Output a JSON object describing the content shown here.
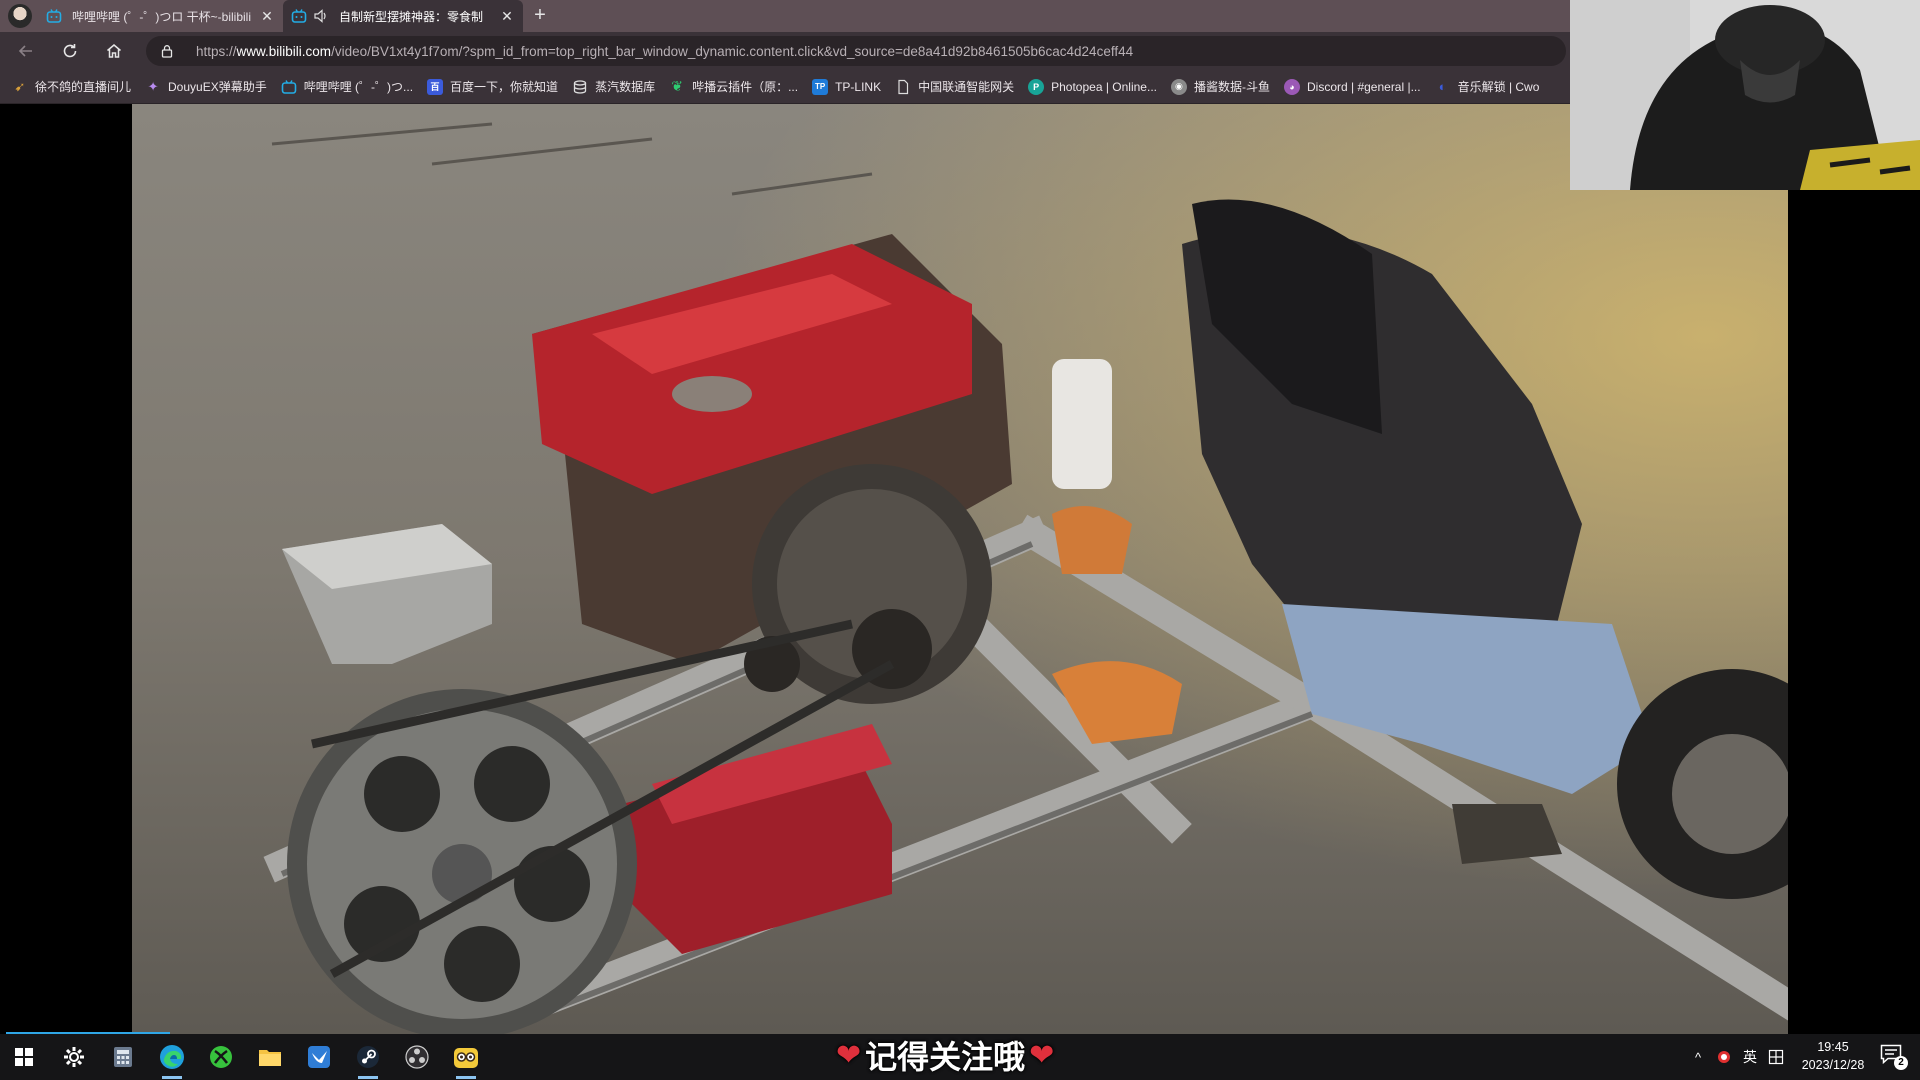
{
  "browser": {
    "tabs": [
      {
        "title": "哔哩哔哩 (゜-゜)つロ 干杯~-bilibili",
        "active": false,
        "icon": "bilibili-icon"
      },
      {
        "title": "自制新型摆摊神器：零食制",
        "active": true,
        "icon": "bilibili-icon"
      }
    ],
    "new_tab_icon": "plus-icon",
    "toolbar": {
      "back_icon": "back-arrow-icon",
      "reload_icon": "reload-icon",
      "home_icon": "home-icon"
    },
    "address": {
      "url_prefix": "https://",
      "url_domain": "www.bilibili.com",
      "url_rest": "/video/BV1xt4y1f7om/?spm_id_from=top_right_bar_window_dynamic.content.click&vd_source=de8a41d92b8461505b6cac4d24ceff44"
    },
    "bookmarks": [
      {
        "label": "徐不鸽的直播间儿",
        "icon": "pin-icon",
        "color": "#d9a03a"
      },
      {
        "label": "DouyuEX弹幕助手",
        "icon": "extension-icon",
        "color": "#b98cf0"
      },
      {
        "label": "哔哩哔哩 (゜-゜)つ...",
        "icon": "bilibili-icon",
        "color": "#23ade5"
      },
      {
        "label": "百度一下，你就知道",
        "icon": "baidu-icon",
        "color": "#3b5bdb"
      },
      {
        "label": "蒸汽数据库",
        "icon": "database-icon",
        "color": "#dcdcdc"
      },
      {
        "label": "哔播云插件（原：...",
        "icon": "leaf-icon",
        "color": "#2ecc71"
      },
      {
        "label": "TP-LINK",
        "icon": "tplink-icon",
        "color": "#1f7bd8"
      },
      {
        "label": "中国联通智能网关",
        "icon": "page-icon",
        "color": "#dcdcdc"
      },
      {
        "label": "Photopea | Online...",
        "icon": "photopea-icon",
        "color": "#18a497"
      },
      {
        "label": "播酱数据-斗鱼",
        "icon": "globe-icon",
        "color": "#c8c8c8"
      },
      {
        "label": "Discord | #general |...",
        "icon": "discord-icon",
        "color": "#9b59b6"
      },
      {
        "label": "音乐解锁 | Cwo",
        "icon": "music-icon",
        "color": "#3b5bdb"
      }
    ]
  },
  "overlay": {
    "caption": "记得关注哦",
    "heart_glyph": "❤"
  },
  "taskbar": {
    "icons": [
      {
        "name": "start-icon",
        "active": false
      },
      {
        "name": "settings-icon",
        "active": false
      },
      {
        "name": "calculator-icon",
        "active": false
      },
      {
        "name": "edge-icon",
        "active": true
      },
      {
        "name": "xbox-icon",
        "active": false
      },
      {
        "name": "file-explorer-icon",
        "active": false
      },
      {
        "name": "feishu-icon",
        "active": false
      },
      {
        "name": "steam-icon",
        "active": false
      },
      {
        "name": "obs-icon",
        "active": false
      },
      {
        "name": "owl-app-icon",
        "active": false
      }
    ],
    "tray": {
      "chevron": "^",
      "ime": "英",
      "clock_time": "19:45",
      "clock_date": "2023/12/28",
      "notification_count": "2"
    }
  },
  "colors": {
    "tabstrip": "#5e4f55",
    "toolbar": "#3a3238",
    "taskbar": "#151517",
    "accent": "#2fa6e6"
  }
}
